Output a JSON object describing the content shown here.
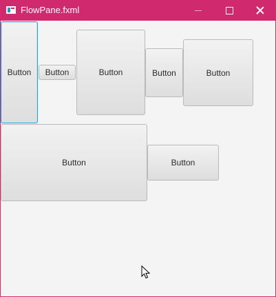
{
  "window": {
    "title": "FlowPane.fxml",
    "accent_color": "#d1296e",
    "controls": {
      "minimize_icon": "minimize-icon",
      "maximize_icon": "maximize-icon",
      "close_icon": "close-icon"
    }
  },
  "flowpane": {
    "buttons": [
      {
        "label": "Button",
        "focused": true
      },
      {
        "label": "Button",
        "focused": false
      },
      {
        "label": "Button",
        "focused": false
      },
      {
        "label": "Button",
        "focused": false
      },
      {
        "label": "Button",
        "focused": false
      },
      {
        "label": "Button",
        "focused": false
      },
      {
        "label": "Button",
        "focused": false
      }
    ],
    "focus_color": "#1ea0d8"
  }
}
